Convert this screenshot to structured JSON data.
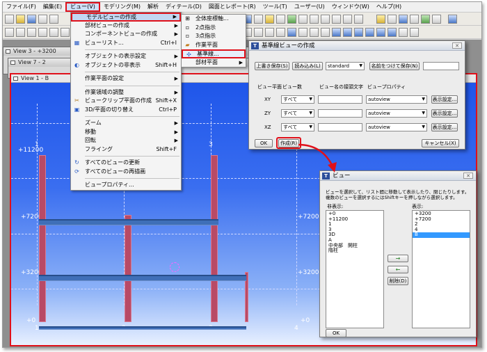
{
  "menubar": {
    "items": [
      "ファイル(F)",
      "編集(E)",
      "ビュー(V)",
      "モデリング(M)",
      "解析",
      "ディテール(D)",
      "図面とレポート(R)",
      "ツール(T)",
      "ユーザー(U)",
      "ウィンドウ(W)",
      "ヘルプ(H)"
    ]
  },
  "windows": {
    "view3_title": "View 3 - +3200",
    "view7_title": "View 7 - 2",
    "view1_title": "View 1 - B"
  },
  "view_menu": {
    "items": [
      {
        "label": "モデルビューの作成",
        "shortcut": "",
        "submenu": true
      },
      {
        "label": "部材ビューの作成",
        "shortcut": "",
        "submenu": true
      },
      {
        "label": "コンポーネントビューの作成",
        "shortcut": "",
        "submenu": true
      },
      {
        "label": "ビューリスト...",
        "shortcut": "Ctrl+I",
        "submenu": false
      },
      {
        "label": "オブジェクトの表示設定",
        "shortcut": "",
        "submenu": true
      },
      {
        "label": "オブジェクトの非表示",
        "shortcut": "Shift+H",
        "submenu": false
      },
      {
        "label": "作業平面の設定",
        "shortcut": "",
        "submenu": true
      },
      {
        "label": "作業領域の調整",
        "shortcut": "",
        "submenu": true
      },
      {
        "label": "ビュークリップ平面の作成",
        "shortcut": "Shift+X",
        "submenu": false
      },
      {
        "label": "3D/平面の切り替え",
        "shortcut": "Ctrl+P",
        "submenu": false
      },
      {
        "label": "ズーム",
        "shortcut": "",
        "submenu": true
      },
      {
        "label": "移動",
        "shortcut": "",
        "submenu": true
      },
      {
        "label": "回転",
        "shortcut": "",
        "submenu": true
      },
      {
        "label": "フライング",
        "shortcut": "Shift+F",
        "submenu": false
      },
      {
        "label": "すべてのビューの更新",
        "shortcut": "",
        "submenu": false
      },
      {
        "label": "すべてのビューの再描画",
        "shortcut": "",
        "submenu": false
      },
      {
        "label": "ビュープロパティ...",
        "shortcut": "",
        "submenu": false
      }
    ]
  },
  "submenu": {
    "items": [
      {
        "label": "全体座標軸...",
        "submenu": false
      },
      {
        "label": "2点指示",
        "submenu": false
      },
      {
        "label": "3点指示",
        "submenu": false
      },
      {
        "label": "作業平面",
        "submenu": false
      },
      {
        "label": "基準線...",
        "submenu": false
      },
      {
        "label": "部材平面",
        "submenu": true
      }
    ]
  },
  "canvas": {
    "levels": [
      "+11200",
      "+7200",
      "+3200",
      "+0"
    ],
    "right_levels": [
      "+7200",
      "+3200",
      "+0"
    ],
    "grid_top": [
      "1",
      "2",
      "3"
    ],
    "grid_bottom": [
      "1",
      "2",
      "3",
      "4"
    ]
  },
  "dialog_grid": {
    "title": "基準線ビューの作成",
    "btn_save": "上書き保存(S)",
    "btn_load": "読み込み(L)",
    "preset": "standard",
    "btn_save_as": "名前をつけて保存(N)",
    "col_plane": "ビュー平面",
    "col_count": "ビュー数",
    "col_prefix": "ビュー名の接頭文字",
    "col_property": "ビュープロパティ",
    "rows": [
      {
        "plane": "XY",
        "count": "すべて",
        "prefix": "",
        "property": "autoview",
        "button": "表示設定..."
      },
      {
        "plane": "ZY",
        "count": "すべて",
        "prefix": "",
        "property": "autoview",
        "button": "表示設定..."
      },
      {
        "plane": "XZ",
        "count": "すべて",
        "prefix": "",
        "property": "autoview",
        "button": "表示設定..."
      }
    ],
    "btn_ok": "OK",
    "btn_create": "作成(R)",
    "btn_cancel": "キャンセル(X)"
  },
  "dialog_view": {
    "title": "ビュー",
    "description_1": "ビューを選択して、リスト間に移動して表示したり、閉じたりします。",
    "description_2": "複数のビューを選択するにはShiftキーを押しながら選択します。",
    "hidden_label": "非表示:",
    "shown_label": "表示:",
    "hidden_items": [
      "+0",
      "+11200",
      "1",
      "3",
      "3D",
      "A",
      "中央部　開柱",
      "階柱"
    ],
    "shown_items": [
      "+3200",
      "+7200",
      "2",
      "4",
      "B"
    ],
    "selected_shown": "B",
    "btn_right_arrow": "→",
    "btn_left_arrow": "←",
    "btn_delete": "削除(D)",
    "btn_ok": "OK"
  }
}
